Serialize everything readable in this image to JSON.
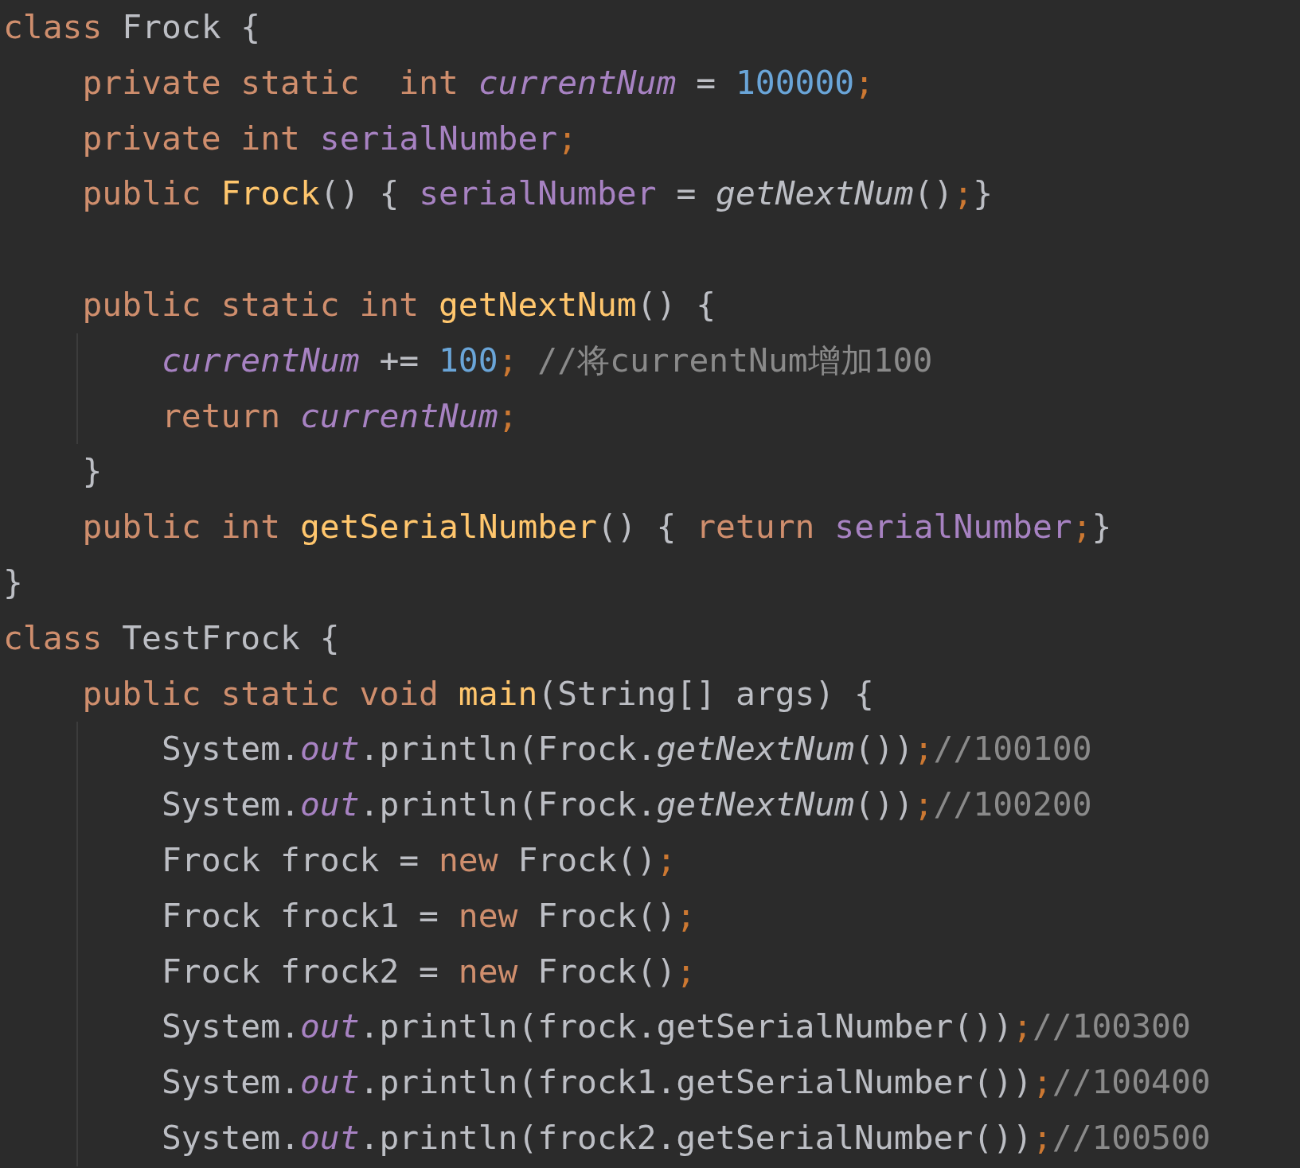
{
  "editor": {
    "lines": [
      {
        "indent_guide": false,
        "tokens": [
          {
            "text": "class ",
            "kind": "keyword"
          },
          {
            "text": "Frock {",
            "kind": "plain"
          }
        ]
      },
      {
        "indent_guide": false,
        "tokens": [
          {
            "text": "    private static  int ",
            "kind": "keyword"
          },
          {
            "text": "currentNum",
            "kind": "static_field"
          },
          {
            "text": " = ",
            "kind": "plain"
          },
          {
            "text": "100000",
            "kind": "number"
          },
          {
            "text": ";",
            "kind": "semicolon"
          }
        ]
      },
      {
        "indent_guide": false,
        "tokens": [
          {
            "text": "    private int ",
            "kind": "keyword"
          },
          {
            "text": "serialNumber",
            "kind": "field"
          },
          {
            "text": ";",
            "kind": "semicolon"
          }
        ]
      },
      {
        "indent_guide": false,
        "tokens": [
          {
            "text": "    public ",
            "kind": "keyword"
          },
          {
            "text": "Frock",
            "kind": "declaration"
          },
          {
            "text": "() { ",
            "kind": "plain"
          },
          {
            "text": "serialNumber",
            "kind": "field"
          },
          {
            "text": " = ",
            "kind": "plain"
          },
          {
            "text": "getNextNum",
            "kind": "static_call"
          },
          {
            "text": "()",
            "kind": "plain"
          },
          {
            "text": ";",
            "kind": "semicolon"
          },
          {
            "text": "}",
            "kind": "plain"
          }
        ]
      },
      {
        "indent_guide": false
      },
      {
        "indent_guide": false,
        "tokens": [
          {
            "text": "    public static int ",
            "kind": "keyword"
          },
          {
            "text": "getNextNum",
            "kind": "declaration"
          },
          {
            "text": "() {",
            "kind": "plain"
          }
        ]
      },
      {
        "indent_guide": true,
        "tokens": [
          {
            "text": "        currentNum",
            "kind": "static_field"
          },
          {
            "text": " += ",
            "kind": "plain"
          },
          {
            "text": "100",
            "kind": "number"
          },
          {
            "text": "; ",
            "kind": "semicolon"
          },
          {
            "text": "//将currentNum增加100",
            "kind": "comment"
          }
        ]
      },
      {
        "indent_guide": true,
        "tokens": [
          {
            "text": "        return ",
            "kind": "keyword"
          },
          {
            "text": "currentNum",
            "kind": "static_field"
          },
          {
            "text": ";",
            "kind": "semicolon"
          }
        ]
      },
      {
        "indent_guide": false,
        "tokens": [
          {
            "text": "    }",
            "kind": "plain"
          }
        ]
      },
      {
        "indent_guide": false,
        "tokens": [
          {
            "text": "    public int ",
            "kind": "keyword"
          },
          {
            "text": "getSerialNumber",
            "kind": "declaration"
          },
          {
            "text": "() { ",
            "kind": "plain"
          },
          {
            "text": "return ",
            "kind": "keyword"
          },
          {
            "text": "serialNumber",
            "kind": "field"
          },
          {
            "text": ";",
            "kind": "semicolon"
          },
          {
            "text": "}",
            "kind": "plain"
          }
        ]
      },
      {
        "indent_guide": false,
        "tokens": [
          {
            "text": "}",
            "kind": "plain"
          }
        ]
      },
      {
        "indent_guide": false,
        "tokens": [
          {
            "text": "class ",
            "kind": "keyword"
          },
          {
            "text": "TestFrock {",
            "kind": "plain"
          }
        ]
      },
      {
        "indent_guide": false,
        "tokens": [
          {
            "text": "    public static void ",
            "kind": "keyword"
          },
          {
            "text": "main",
            "kind": "declaration"
          },
          {
            "text": "(String[] args) {",
            "kind": "plain"
          }
        ]
      },
      {
        "indent_guide": true,
        "tokens": [
          {
            "text": "        System.",
            "kind": "plain"
          },
          {
            "text": "out",
            "kind": "static_field"
          },
          {
            "text": ".println(Frock.",
            "kind": "plain"
          },
          {
            "text": "getNextNum",
            "kind": "static_call"
          },
          {
            "text": "())",
            "kind": "plain"
          },
          {
            "text": ";",
            "kind": "semicolon"
          },
          {
            "text": "//100100",
            "kind": "comment"
          }
        ]
      },
      {
        "indent_guide": true,
        "tokens": [
          {
            "text": "        System.",
            "kind": "plain"
          },
          {
            "text": "out",
            "kind": "static_field"
          },
          {
            "text": ".println(Frock.",
            "kind": "plain"
          },
          {
            "text": "getNextNum",
            "kind": "static_call"
          },
          {
            "text": "())",
            "kind": "plain"
          },
          {
            "text": ";",
            "kind": "semicolon"
          },
          {
            "text": "//100200",
            "kind": "comment"
          }
        ]
      },
      {
        "indent_guide": true,
        "tokens": [
          {
            "text": "        Frock frock = ",
            "kind": "plain"
          },
          {
            "text": "new ",
            "kind": "keyword"
          },
          {
            "text": "Frock()",
            "kind": "plain"
          },
          {
            "text": ";",
            "kind": "semicolon"
          }
        ]
      },
      {
        "indent_guide": true,
        "tokens": [
          {
            "text": "        Frock frock1 = ",
            "kind": "plain"
          },
          {
            "text": "new ",
            "kind": "keyword"
          },
          {
            "text": "Frock()",
            "kind": "plain"
          },
          {
            "text": ";",
            "kind": "semicolon"
          }
        ]
      },
      {
        "indent_guide": true,
        "tokens": [
          {
            "text": "        Frock frock2 = ",
            "kind": "plain"
          },
          {
            "text": "new ",
            "kind": "keyword"
          },
          {
            "text": "Frock()",
            "kind": "plain"
          },
          {
            "text": ";",
            "kind": "semicolon"
          }
        ]
      },
      {
        "indent_guide": true,
        "tokens": [
          {
            "text": "        System.",
            "kind": "plain"
          },
          {
            "text": "out",
            "kind": "static_field"
          },
          {
            "text": ".println(frock.getSerialNumber())",
            "kind": "plain"
          },
          {
            "text": ";",
            "kind": "semicolon"
          },
          {
            "text": "//100300",
            "kind": "comment"
          }
        ]
      },
      {
        "indent_guide": true,
        "tokens": [
          {
            "text": "        System.",
            "kind": "plain"
          },
          {
            "text": "out",
            "kind": "static_field"
          },
          {
            "text": ".println(frock1.getSerialNumber())",
            "kind": "plain"
          },
          {
            "text": ";",
            "kind": "semicolon"
          },
          {
            "text": "//100400",
            "kind": "comment"
          }
        ]
      },
      {
        "indent_guide": true,
        "tokens": [
          {
            "text": "        System.",
            "kind": "plain"
          },
          {
            "text": "out",
            "kind": "static_field"
          },
          {
            "text": ".println(frock2.getSerialNumber())",
            "kind": "plain"
          },
          {
            "text": ";",
            "kind": "semicolon"
          },
          {
            "text": "//100500",
            "kind": "comment"
          }
        ]
      }
    ]
  }
}
